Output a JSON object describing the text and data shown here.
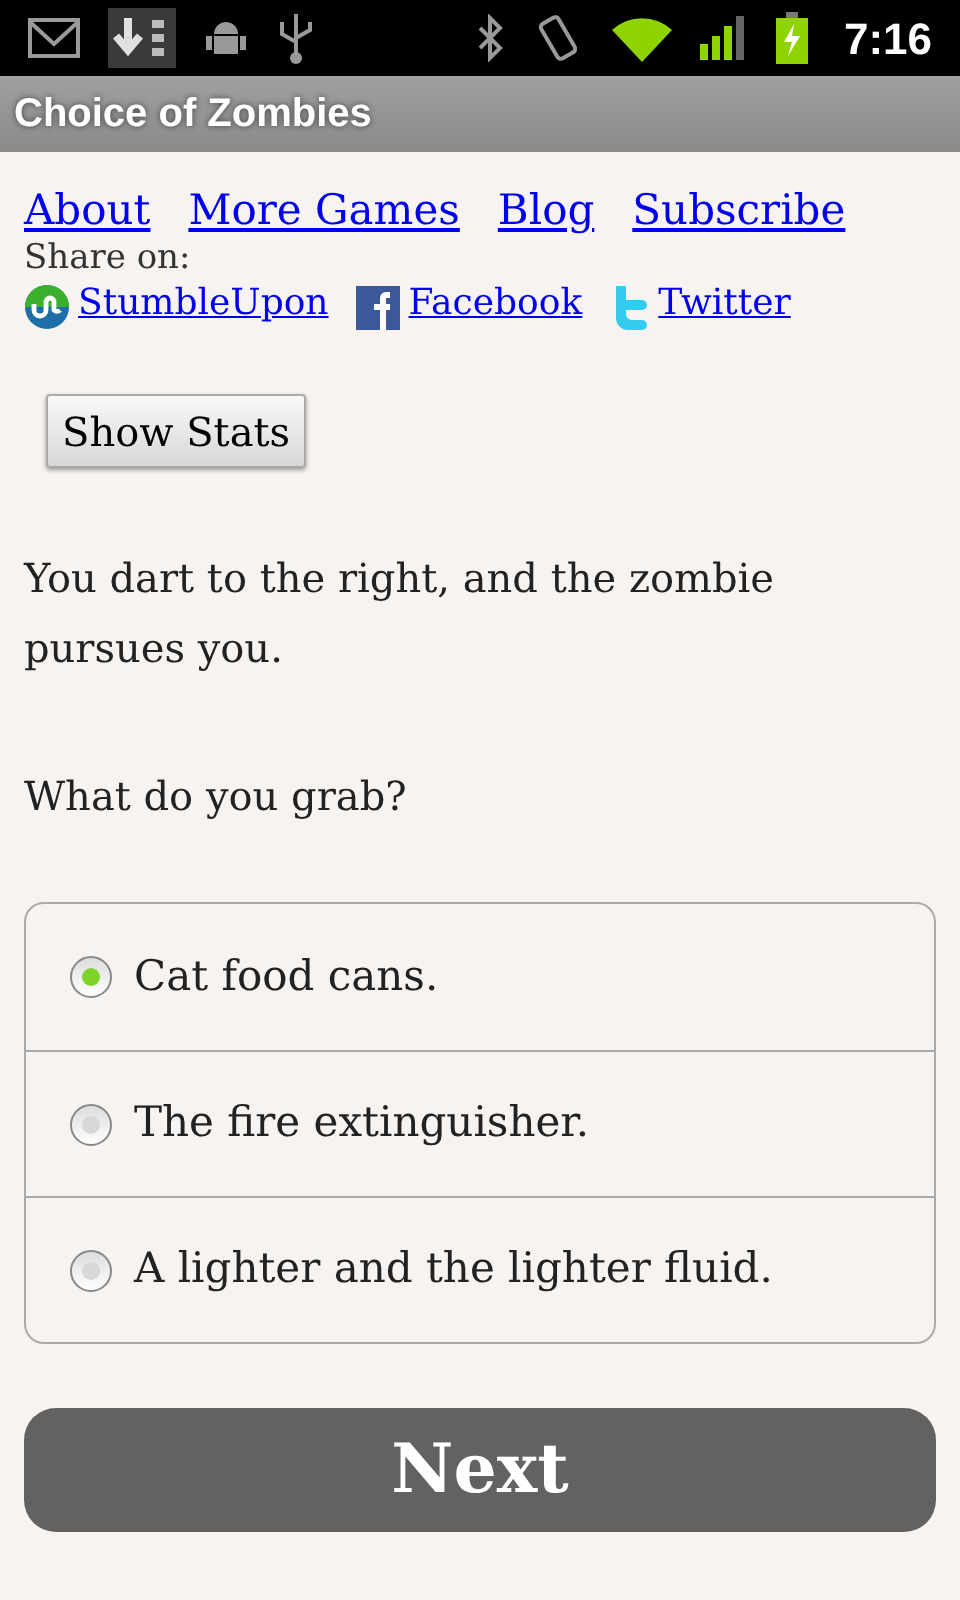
{
  "status_bar": {
    "time": "7:16"
  },
  "title_bar": {
    "title": "Choice of Zombies"
  },
  "nav_links": [
    "About",
    "More Games",
    "Blog",
    "Subscribe"
  ],
  "share": {
    "label": "Share on:",
    "links": [
      {
        "kind": "stumbleupon",
        "label": "StumbleUpon"
      },
      {
        "kind": "facebook",
        "label": "Facebook"
      },
      {
        "kind": "twitter",
        "label": "Twitter"
      }
    ]
  },
  "stats_button": "Show Stats",
  "paragraphs": [
    "You dart to the right, and the zombie pursues you.",
    "What do you grab?"
  ],
  "choices": [
    {
      "label": "Cat food cans.",
      "selected": true
    },
    {
      "label": "The fire extinguisher.",
      "selected": false
    },
    {
      "label": "A lighter and the lighter fluid.",
      "selected": false
    }
  ],
  "next_button": "Next"
}
